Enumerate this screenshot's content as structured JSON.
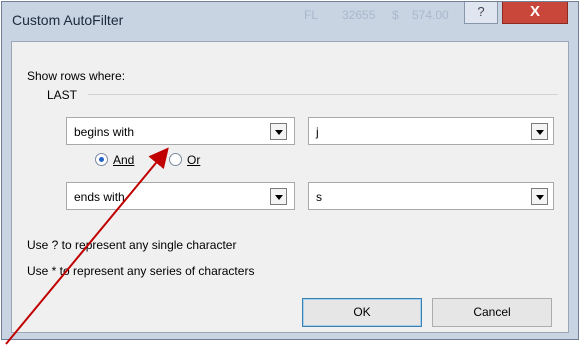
{
  "window": {
    "title": "Custom AutoFilter",
    "help_glyph": "?",
    "close_glyph": "X",
    "background_text": [
      "FL",
      "32655",
      "$",
      "574.00"
    ]
  },
  "filter": {
    "show_rows_label": "Show rows where:",
    "field_name": "LAST",
    "condition1": {
      "operator": "begins with",
      "value": "j"
    },
    "logic": {
      "and_label": "And",
      "or_label": "Or",
      "selected": "And"
    },
    "condition2": {
      "operator": "ends with",
      "value": "s"
    }
  },
  "hints": {
    "single_char": "Use ? to represent any single character",
    "series_chars": "Use * to represent any series of characters"
  },
  "buttons": {
    "ok": "OK",
    "cancel": "Cancel"
  },
  "annotation": {
    "arrow_color": "#c00000"
  }
}
